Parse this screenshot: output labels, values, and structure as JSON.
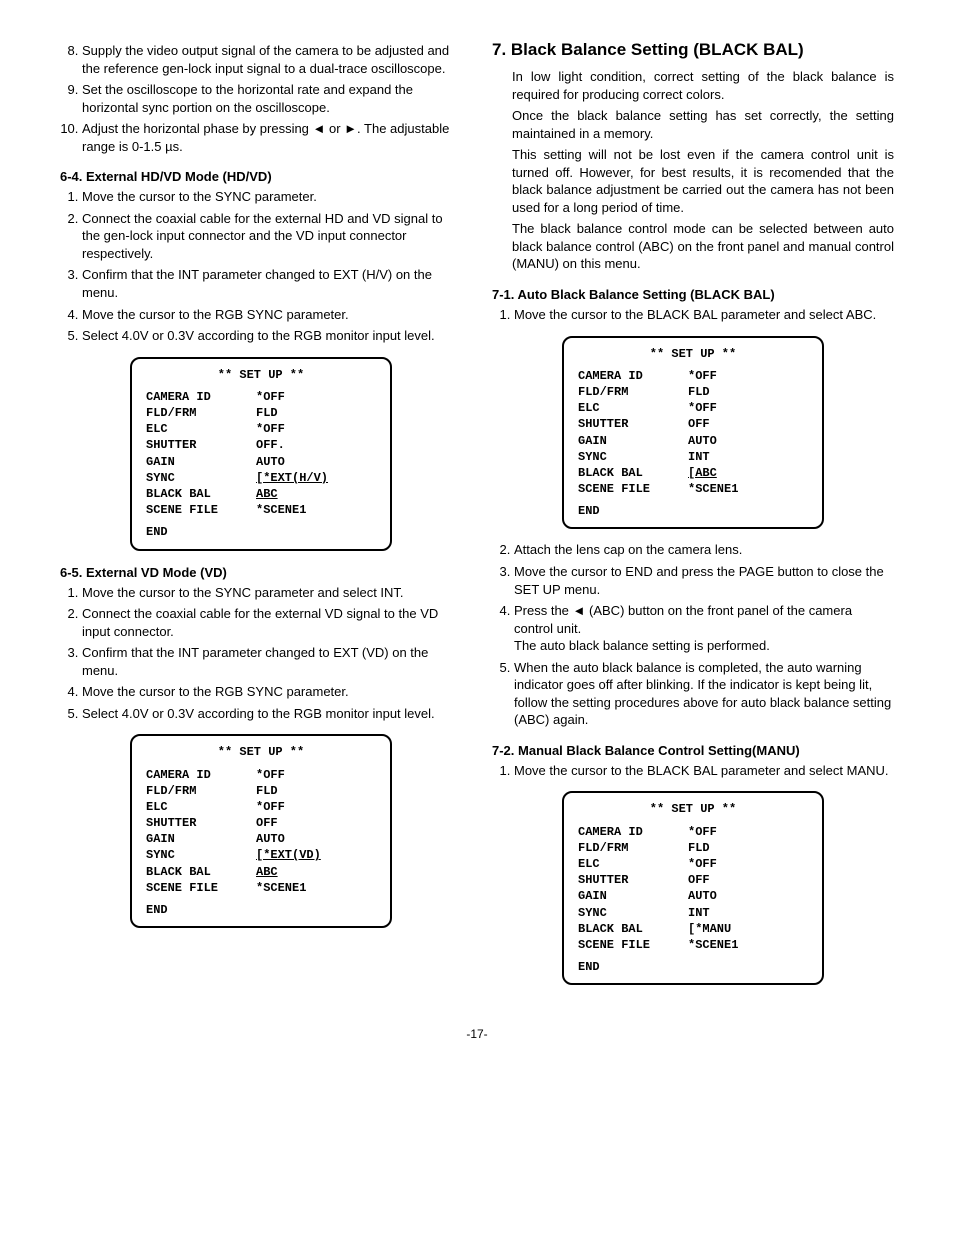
{
  "left": {
    "list_pre": [
      "Supply the video output signal of the camera to be adjusted and the reference gen-lock input signal to a dual-trace oscilloscope.",
      "Set the oscilloscope to the horizontal rate and expand the horizontal sync portion on the oscilloscope.",
      "Adjust the horizontal phase by pressing ◄ or ►. The adjustable range is 0-1.5 µs."
    ],
    "sec64_title": "6-4. External HD/VD Mode (HD/VD)",
    "sec64": [
      "Move the cursor to the SYNC parameter.",
      "Connect the coaxial cable for the external HD and VD signal to the gen-lock input connector and the VD input connector respectively.",
      "Confirm that the INT parameter changed to EXT (H/V) on the menu.",
      "Move the cursor to the RGB SYNC parameter.",
      "Select 4.0V or 0.3V according to the RGB monitor input level."
    ],
    "sec65_title": "6-5. External VD Mode (VD)",
    "sec65": [
      "Move the cursor to the SYNC parameter and select INT.",
      "Connect the coaxial cable for the external VD signal to the VD input connector.",
      "Confirm that the INT parameter changed to EXT (VD) on the menu.",
      "Move the cursor to the RGB SYNC parameter.",
      "Select 4.0V or 0.3V according to the RGB monitor input level."
    ]
  },
  "right": {
    "h": "7. Black Balance Setting (BLACK BAL)",
    "intro": [
      "In low light condition, correct setting of the black balance is required for producing correct colors.",
      "Once the black balance setting has set correctly, the setting maintained in a memory.",
      "This setting will not be lost even if the camera control unit is turned off. However, for best results, it is recomended that the black balance adjustment be carried out the camera has not been used for a long period of time.",
      "The black balance control mode can be selected between auto black balance control (ABC) on the front panel and manual control (MANU) on this menu."
    ],
    "sec71_title": "7-1. Auto Black Balance Setting (BLACK BAL)",
    "sec71_pre": [
      "Move the cursor to the BLACK BAL parameter and select ABC."
    ],
    "sec71_post": [
      "Attach the lens cap on the camera lens.",
      "Move the cursor to END and press the PAGE button to close the SET UP menu.",
      "Press the ◄ (ABC) button on the front panel of the camera control unit.\nThe auto black balance setting is performed.",
      "When the auto black balance is completed, the auto warning indicator goes off after blinking. If the indicator is kept being lit, follow the setting procedures above for auto black balance setting (ABC) again."
    ],
    "sec72_title": "7-2. Manual Black Balance Control Setting(MANU)",
    "sec72": [
      "Move the cursor to the BLACK BAL parameter and select MANU."
    ]
  },
  "setup": {
    "title": "** SET UP **",
    "labels": [
      "CAMERA ID",
      "FLD/FRM",
      "ELC",
      "SHUTTER",
      "GAIN",
      "SYNC",
      "BLACK BAL",
      "SCENE FILE"
    ],
    "end": "END",
    "box1_vals": [
      "*OFF",
      "FLD",
      "*OFF",
      "OFF.",
      "AUTO",
      "[*EXT(H/V)",
      "ABC",
      "*SCENE1"
    ],
    "box1_ul": [
      false,
      false,
      false,
      false,
      false,
      true,
      true,
      false
    ],
    "box2_vals": [
      "*OFF",
      "FLD",
      "*OFF",
      "OFF",
      "AUTO",
      "[*EXT(VD)",
      "ABC",
      "*SCENE1"
    ],
    "box2_ul": [
      false,
      false,
      false,
      false,
      false,
      true,
      true,
      false
    ],
    "box3_vals": [
      "*OFF",
      "FLD",
      "*OFF",
      "OFF",
      "AUTO",
      "INT",
      "[ABC",
      "*SCENE1"
    ],
    "box3_ul": [
      false,
      false,
      false,
      false,
      false,
      false,
      true,
      false
    ],
    "box4_vals": [
      "*OFF",
      "FLD",
      "*OFF",
      "OFF",
      "AUTO",
      "INT",
      "[*MANU",
      "*SCENE1"
    ],
    "box4_ul": [
      false,
      false,
      false,
      false,
      false,
      false,
      false,
      false
    ]
  },
  "pagenum": "-17-"
}
